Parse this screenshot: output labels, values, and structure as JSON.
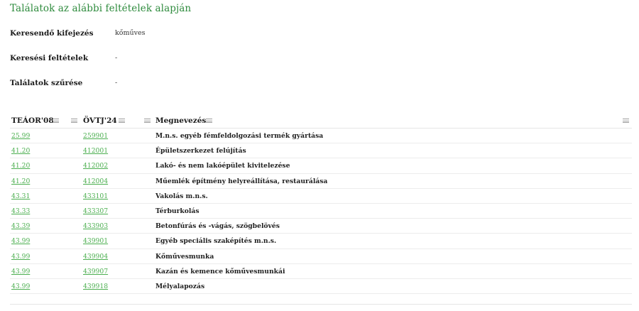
{
  "page": {
    "title": "Találatok az alábbi feltételek alapján"
  },
  "criteria": [
    {
      "label": "Keresendő kifejezés",
      "value": "kőműves"
    },
    {
      "label": "Keresési feltételek",
      "value": "-"
    },
    {
      "label": "Találatok szűrése",
      "value": "-"
    }
  ],
  "table": {
    "columns": [
      "TEÁOR'08",
      "ÖVTJ'24",
      "Megnevezés"
    ],
    "rows": [
      {
        "teaor": "25.99",
        "ovtj": "259901",
        "name": "M.n.s. egyéb fémfeldolgozási termék gyártása"
      },
      {
        "teaor": "41.20",
        "ovtj": "412001",
        "name": "Épületszerkezet felújítás"
      },
      {
        "teaor": "41.20",
        "ovtj": "412002",
        "name": "Lakó- és nem lakóépület kivitelezése"
      },
      {
        "teaor": "41.20",
        "ovtj": "412004",
        "name": "Műemlék építmény helyreállítása, restaurálása"
      },
      {
        "teaor": "43.31",
        "ovtj": "433101",
        "name": "Vakolás m.n.s."
      },
      {
        "teaor": "43.33",
        "ovtj": "433307",
        "name": "Térburkolás"
      },
      {
        "teaor": "43.39",
        "ovtj": "433903",
        "name": "Betonfúrás és -vágás, szögbelövés"
      },
      {
        "teaor": "43.99",
        "ovtj": "439901",
        "name": "Egyéb speciális szaképítés m.n.s."
      },
      {
        "teaor": "43.99",
        "ovtj": "439904",
        "name": "Kőművesmunka"
      },
      {
        "teaor": "43.99",
        "ovtj": "439907",
        "name": "Kazán és kemence kőművesmunkái"
      },
      {
        "teaor": "43.99",
        "ovtj": "439918",
        "name": "Mélyalapozás"
      }
    ]
  }
}
